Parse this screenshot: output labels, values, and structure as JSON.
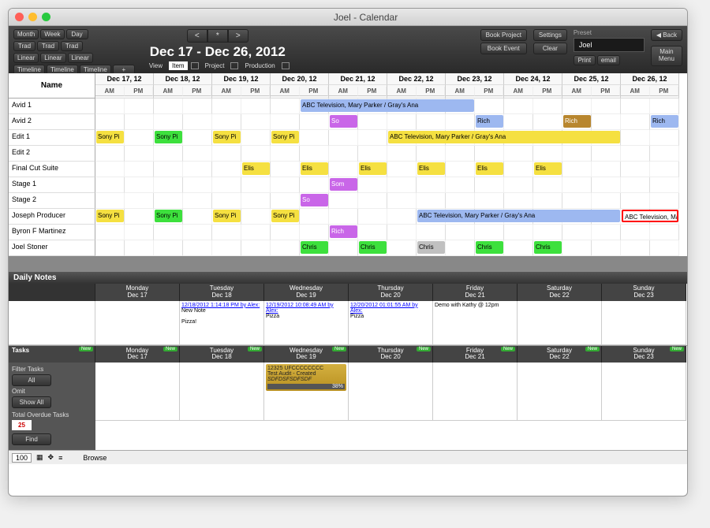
{
  "window": {
    "title": "Joel - Calendar"
  },
  "toolbar": {
    "view_modes": [
      "Month",
      "Week",
      "Day"
    ],
    "row2": [
      "Trad",
      "Trad",
      "Trad"
    ],
    "row3": [
      "Linear",
      "Linear",
      "Linear"
    ],
    "row4": [
      "Timeline",
      "Timeline",
      "Timeline",
      "+"
    ],
    "nav_prev": "<",
    "nav_star": "*",
    "nav_next": ">",
    "date_range": "Dec 17 - Dec 26,  2012",
    "view_label": "View",
    "item_label": "Item",
    "project_label": "Project",
    "production_label": "Production",
    "book_project": "Book Project",
    "book_event": "Book Event",
    "settings": "Settings",
    "clear": "Clear",
    "preset_label": "Preset",
    "preset_value": "Joel",
    "print": "Print",
    "email": "email",
    "back": "Back",
    "main_menu": "Main\nMenu"
  },
  "calendar": {
    "name_header": "Name",
    "dates": [
      "Dec 17, 12",
      "Dec 18, 12",
      "Dec 19, 12",
      "Dec 20, 12",
      "Dec 21, 12",
      "Dec 22, 12",
      "Dec 23, 12",
      "Dec 24, 12",
      "Dec 25, 12",
      "Dec 26, 12"
    ],
    "ampm": [
      "AM",
      "PM"
    ],
    "rows": [
      "Avid 1",
      "Avid 2",
      "Edit 1",
      "Edit 2",
      "Final Cut Suite",
      "Stage 1",
      "Stage 2",
      "Joseph Producer",
      "Byron F Martinez",
      "Joel Stoner"
    ],
    "events": [
      {
        "row": 0,
        "start": 7,
        "span": 6,
        "cls": "ev-blue",
        "txt": "ABC Television, Mary Parker  /  Gray's Ana"
      },
      {
        "row": 1,
        "start": 8,
        "span": 1,
        "cls": "ev-purple",
        "txt": "So"
      },
      {
        "row": 1,
        "start": 13,
        "span": 1,
        "cls": "ev-blue",
        "txt": "Rich"
      },
      {
        "row": 1,
        "start": 16,
        "span": 1,
        "cls": "ev-brown",
        "txt": "Rich"
      },
      {
        "row": 1,
        "start": 19,
        "span": 1,
        "cls": "ev-blue",
        "txt": "Rich"
      },
      {
        "row": 2,
        "start": 0,
        "span": 1,
        "cls": "ev-yellow",
        "txt": "Sony Pi"
      },
      {
        "row": 2,
        "start": 2,
        "span": 1,
        "cls": "ev-green",
        "txt": "Sony Pi"
      },
      {
        "row": 2,
        "start": 4,
        "span": 1,
        "cls": "ev-yellow",
        "txt": "Sony Pi"
      },
      {
        "row": 2,
        "start": 6,
        "span": 1,
        "cls": "ev-yellow",
        "txt": "Sony Pi"
      },
      {
        "row": 2,
        "start": 10,
        "span": 8,
        "cls": "ev-yellow",
        "txt": "ABC Television, Mary Parker  /  Gray's Ana"
      },
      {
        "row": 4,
        "start": 5,
        "span": 1,
        "cls": "ev-yellow",
        "txt": "Elis"
      },
      {
        "row": 4,
        "start": 7,
        "span": 1,
        "cls": "ev-yellow",
        "txt": "Elis"
      },
      {
        "row": 4,
        "start": 9,
        "span": 1,
        "cls": "ev-yellow",
        "txt": "Elis"
      },
      {
        "row": 4,
        "start": 11,
        "span": 1,
        "cls": "ev-yellow",
        "txt": "Elis"
      },
      {
        "row": 4,
        "start": 13,
        "span": 1,
        "cls": "ev-yellow",
        "txt": "Elis"
      },
      {
        "row": 4,
        "start": 15,
        "span": 1,
        "cls": "ev-yellow",
        "txt": "Elis"
      },
      {
        "row": 5,
        "start": 8,
        "span": 1,
        "cls": "ev-purple",
        "txt": "Som"
      },
      {
        "row": 6,
        "start": 7,
        "span": 1,
        "cls": "ev-purple",
        "txt": "So"
      },
      {
        "row": 7,
        "start": 0,
        "span": 1,
        "cls": "ev-yellow",
        "txt": "Sony Pi"
      },
      {
        "row": 7,
        "start": 2,
        "span": 1,
        "cls": "ev-green",
        "txt": "Sony Pi"
      },
      {
        "row": 7,
        "start": 4,
        "span": 1,
        "cls": "ev-yellow",
        "txt": "Sony Pi"
      },
      {
        "row": 7,
        "start": 6,
        "span": 1,
        "cls": "ev-yellow",
        "txt": "Sony Pi"
      },
      {
        "row": 7,
        "start": 11,
        "span": 7,
        "cls": "ev-blue",
        "txt": "ABC Television, Mary Parker  /  Gray's Ana"
      },
      {
        "row": 7,
        "start": 18,
        "span": 2,
        "cls": "ev-redborder",
        "txt": "ABC Television, Mar"
      },
      {
        "row": 8,
        "start": 8,
        "span": 1,
        "cls": "ev-purple",
        "txt": "Rich"
      },
      {
        "row": 9,
        "start": 7,
        "span": 1,
        "cls": "ev-green",
        "txt": "Chris"
      },
      {
        "row": 9,
        "start": 9,
        "span": 1,
        "cls": "ev-green",
        "txt": "Chris"
      },
      {
        "row": 9,
        "start": 11,
        "span": 1,
        "cls": "ev-gray",
        "txt": "Chris"
      },
      {
        "row": 9,
        "start": 13,
        "span": 1,
        "cls": "ev-green",
        "txt": "Chris"
      },
      {
        "row": 9,
        "start": 15,
        "span": 1,
        "cls": "ev-green",
        "txt": "Chris"
      }
    ]
  },
  "notes": {
    "title": "Daily Notes",
    "days": [
      {
        "label": "Monday",
        "date": "Dec 17"
      },
      {
        "label": "Tuesday",
        "date": "Dec 18"
      },
      {
        "label": "Wednesday",
        "date": "Dec 19"
      },
      {
        "label": "Thursday",
        "date": "Dec 20"
      },
      {
        "label": "Friday",
        "date": "Dec 21"
      },
      {
        "label": "Saturday",
        "date": "Dec 22"
      },
      {
        "label": "Sunday",
        "date": "Dec 23"
      }
    ],
    "entries": [
      {
        "col": 1,
        "link": "12/18/2012 1:14:18 PM by Alex:",
        "body": "New Note\n\nPizza!"
      },
      {
        "col": 2,
        "link": "12/19/2012 10:08:49 AM by Alex:",
        "body": "Pizza"
      },
      {
        "col": 3,
        "link": "12/20/2012 01:01:55 AM by Alex:",
        "body": "Pizza"
      },
      {
        "col": 4,
        "link": "",
        "body": "Demo with Kathy @ 12pm"
      }
    ]
  },
  "tasks": {
    "title": "Tasks",
    "new": "New",
    "days": [
      {
        "label": "Monday",
        "date": "Dec 17"
      },
      {
        "label": "Tuesday",
        "date": "Dec 18"
      },
      {
        "label": "Wednesday",
        "date": "Dec 19"
      },
      {
        "label": "Thursday",
        "date": "Dec 20"
      },
      {
        "label": "Friday",
        "date": "Dec 21"
      },
      {
        "label": "Saturday",
        "date": "Dec 22"
      },
      {
        "label": "Sunday",
        "date": "Dec 23"
      }
    ],
    "filter_label": "Filter Tasks",
    "all": "All",
    "omit": "Omit",
    "show_all": "Show All",
    "overdue_label": "Total Overdue Tasks",
    "overdue_count": "25",
    "find": "Find",
    "card": {
      "col": 2,
      "title": "12325 UFCCCCCCCC",
      "line2": "Test Audit - Created",
      "line3": "SDFDSFSDFSDF",
      "progress": "38%"
    }
  },
  "status": {
    "zoom": "100",
    "mode": "Browse"
  }
}
